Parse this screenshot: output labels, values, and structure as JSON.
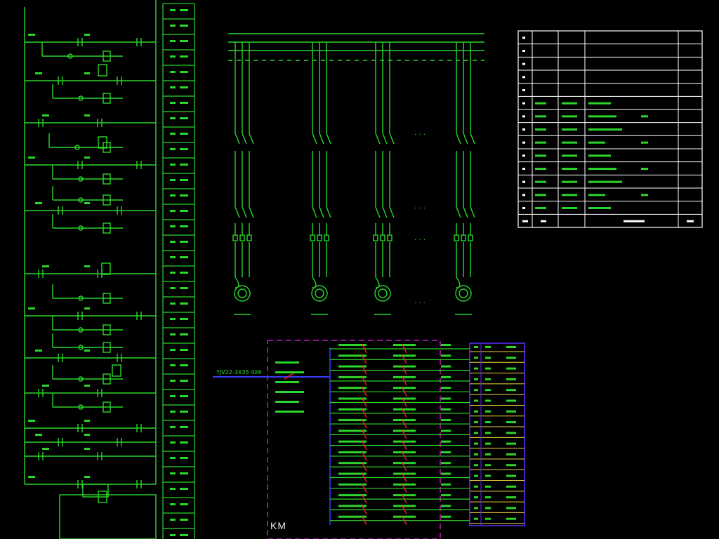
{
  "colors": {
    "background": "#000000",
    "wire": "#2bd62b",
    "table_line": "#ffffff",
    "text_green": "#2bd62b",
    "dashed_box": "#c018c0",
    "busbar": "#3a3aff",
    "terminal_box": "#5a2cff",
    "terminal_row": "#f0d040",
    "breaker_mark": "#ff2020"
  },
  "icons": [
    "motor-icon",
    "breaker-icon",
    "contactor-icon",
    "relay-coil-icon"
  ],
  "schematic": {
    "km_label": "KM",
    "main_feed_label": "YJV22-3X35 4X6",
    "motor_branches": 4,
    "ellipsis": "· · ·"
  },
  "spec_table": {
    "rows": 14,
    "columns": 5
  },
  "terminal_block": {
    "rows": 17
  }
}
